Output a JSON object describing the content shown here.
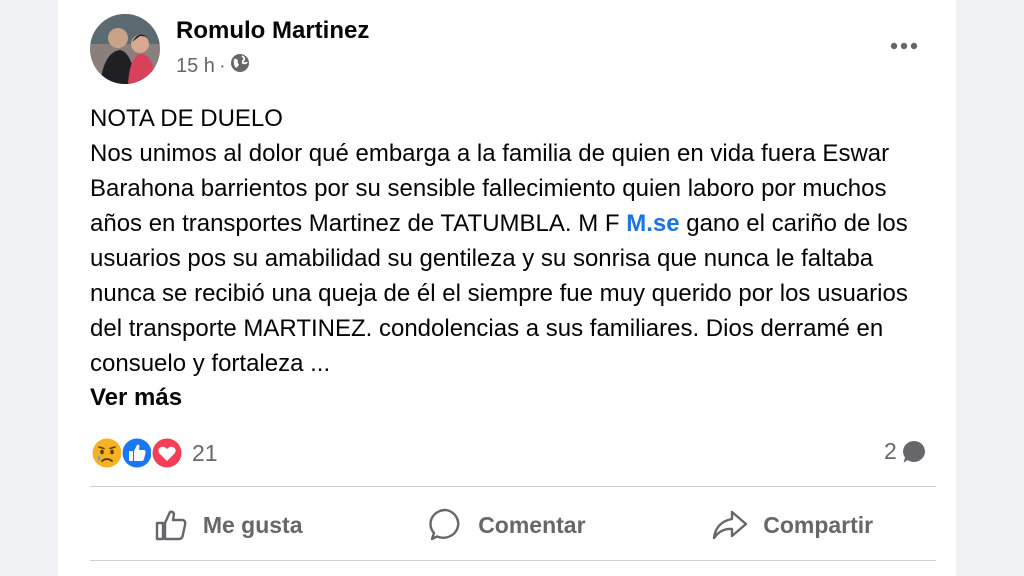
{
  "post": {
    "author": "Romulo Martinez",
    "time": "15 h",
    "separator": "·",
    "privacy_icon": "globe-icon",
    "more_icon": "more-horizontal-icon",
    "title_line": "NOTA DE DUELO",
    "body_before_mention": "Nos unimos al dolor qué embarga a la familia de quien en vida fuera Eswar Barahona barrientos por su sensible fallecimiento quien laboro por muchos años en transportes Martinez de TATUMBLA. M F ",
    "mention": "M.se",
    "body_after_mention": " gano el cariño de los usuarios pos su amabilidad su gentileza y su sonrisa que nunca le faltaba nunca se recibió una queja de él el siempre fue muy querido por los usuarios del transporte MARTINEZ. condolencias a sus familiares. Dios derramé en consuelo y fortaleza ...",
    "see_more": "Ver más"
  },
  "stats": {
    "reactions": [
      "sad",
      "like",
      "love"
    ],
    "reaction_count": "21",
    "comment_count": "2"
  },
  "actions": {
    "like": "Me gusta",
    "comment": "Comentar",
    "share": "Compartir"
  },
  "colors": {
    "mention": "#1b74e4",
    "like": "#1877f2",
    "love": "#f33e58",
    "sad": "#f7b125",
    "secondary_text": "#65676b"
  }
}
